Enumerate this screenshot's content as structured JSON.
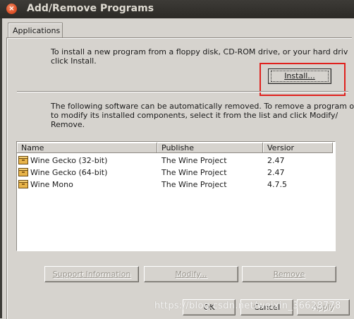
{
  "window": {
    "title": "Add/Remove Programs",
    "close_glyph": "×"
  },
  "tabs": [
    {
      "label": "Applications"
    }
  ],
  "install_section": {
    "instruction_line1": "To install a new program from a floppy disk, CD-ROM drive, or your hard driv",
    "instruction_line2": "click Install.",
    "install_label": "Install..."
  },
  "remove_section": {
    "instruction_line1": "The following software can be automatically removed. To remove a program o",
    "instruction_line2": "to modify its installed components, select it from the list and click Modify/",
    "instruction_line3": "Remove."
  },
  "list": {
    "columns": [
      "Name",
      "Publishe",
      "Versior"
    ],
    "rows": [
      {
        "name": "Wine Gecko (32-bit)",
        "publisher": "The Wine Project",
        "version": "2.47"
      },
      {
        "name": "Wine Gecko (64-bit)",
        "publisher": "The Wine Project",
        "version": "2.47"
      },
      {
        "name": "Wine Mono",
        "publisher": "The Wine Project",
        "version": "4.7.5"
      }
    ]
  },
  "actions": {
    "support_label": "Support Information",
    "modify_label": "Modify...",
    "remove_label": "Remove"
  },
  "footer": {
    "ok_label": "OK",
    "cancel_label": "Cancel",
    "apply_label": "Apply"
  },
  "watermark": "https://blog.csdn.net/weixin_36628778",
  "colors": {
    "highlight_box": "#e0211d",
    "titlebar": "#2c2a26"
  },
  "icons": {
    "close": "close-icon",
    "package": "package-icon"
  }
}
